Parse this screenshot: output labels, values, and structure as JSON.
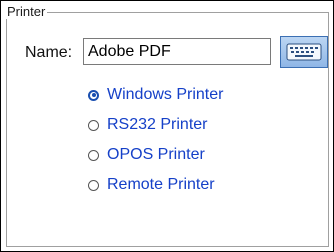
{
  "group": {
    "legend": "Printer"
  },
  "name_field": {
    "label": "Name:",
    "value": "Adobe PDF"
  },
  "keyboard_button": {
    "icon": "keyboard-icon"
  },
  "printer_types": [
    {
      "label": "Windows Printer",
      "selected": true
    },
    {
      "label": "RS232 Printer",
      "selected": false
    },
    {
      "label": "OPOS Printer",
      "selected": false
    },
    {
      "label": "Remote Printer",
      "selected": false
    }
  ],
  "colors": {
    "accent": "#1540c8",
    "button_blue": "#8fb6e6"
  }
}
